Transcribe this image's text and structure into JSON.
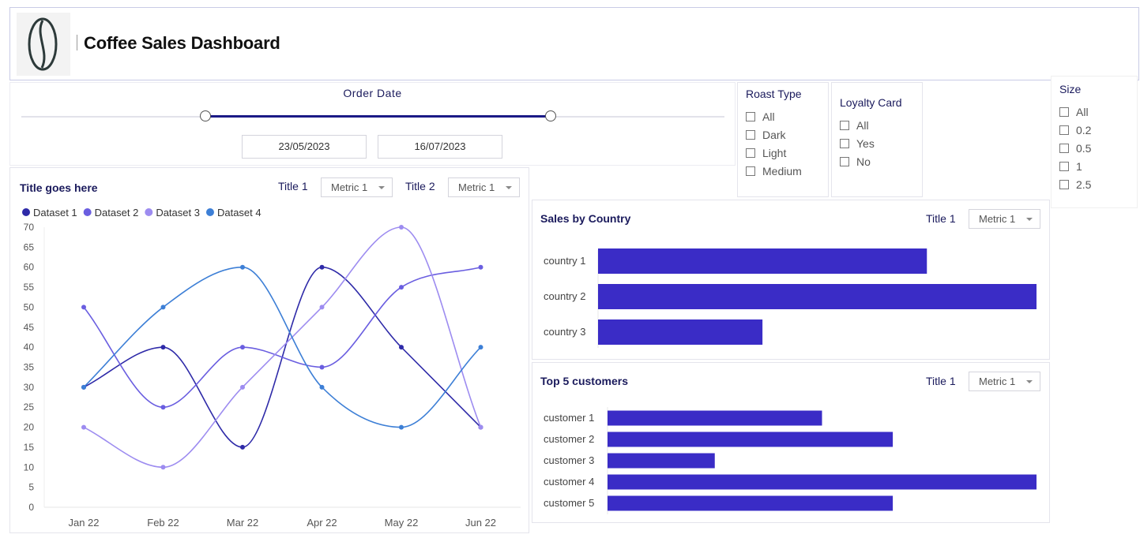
{
  "header": {
    "title": "Coffee Sales Dashboard",
    "logo_icon": "coffee-bean-icon"
  },
  "order_date": {
    "label": "Order Date",
    "start": "23/05/2023",
    "end": "16/07/2023",
    "range_fraction": [
      0.262,
      0.753
    ]
  },
  "roast_type": {
    "title": "Roast Type",
    "options": [
      "All",
      "Dark",
      "Light",
      "Medium"
    ]
  },
  "loyalty_card": {
    "title": "Loyalty Card",
    "options": [
      "All",
      "Yes",
      "No"
    ]
  },
  "size_filter": {
    "title": "Size",
    "options": [
      "All",
      "0.2",
      "0.5",
      "1",
      "2.5"
    ]
  },
  "line_chart": {
    "title": "Title goes here",
    "control1_label": "Title 1",
    "control1_value": "Metric 1",
    "control2_label": "Title 2",
    "control2_value": "Metric 1"
  },
  "country_chart": {
    "title": "Sales by Country",
    "control_label": "Title 1",
    "control_value": "Metric 1"
  },
  "customer_chart": {
    "title": "Top 5 customers",
    "control_label": "Title 1",
    "control_value": "Metric 1"
  },
  "chart_data": [
    {
      "type": "line",
      "title": "Title goes here",
      "x": [
        "Jan 22",
        "Feb 22",
        "Mar 22",
        "Apr 22",
        "May 22",
        "Jun 22"
      ],
      "ylim": [
        0,
        70
      ],
      "yticks": [
        0,
        5,
        10,
        15,
        20,
        25,
        30,
        35,
        40,
        45,
        50,
        55,
        60,
        65,
        70
      ],
      "legend": "top-left",
      "grid": false,
      "series": [
        {
          "name": "Dataset 1",
          "color": "#2e2aa8",
          "values": [
            30,
            40,
            15,
            60,
            40,
            20
          ]
        },
        {
          "name": "Dataset 2",
          "color": "#6a5ee0",
          "values": [
            50,
            25,
            40,
            35,
            55,
            60
          ]
        },
        {
          "name": "Dataset 3",
          "color": "#9d8cf0",
          "values": [
            20,
            10,
            30,
            50,
            70,
            20
          ]
        },
        {
          "name": "Dataset 4",
          "color": "#3d7fd6",
          "values": [
            30,
            50,
            60,
            30,
            20,
            40
          ]
        }
      ]
    },
    {
      "type": "bar",
      "orientation": "horizontal",
      "title": "Sales by Country",
      "categories": [
        "country 1",
        "country 2",
        "country 3"
      ],
      "values": [
        75,
        100,
        37.5
      ],
      "color": "#3a2cc6"
    },
    {
      "type": "bar",
      "orientation": "horizontal",
      "title": "Top 5 customers",
      "categories": [
        "customer 1",
        "customer 2",
        "customer 3",
        "customer 4",
        "customer 5"
      ],
      "values": [
        50,
        66.5,
        25,
        100,
        66.5
      ],
      "color": "#3a2cc6"
    }
  ]
}
